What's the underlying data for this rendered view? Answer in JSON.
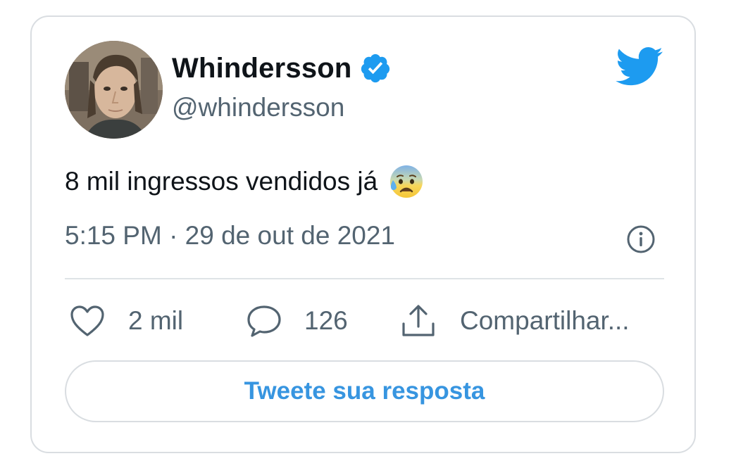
{
  "tweet": {
    "author": {
      "display_name": "Whindersson",
      "handle": "@whindersson",
      "verified": true,
      "avatar_icon": "profile-photo"
    },
    "text": "8 mil ingressos vendidos já",
    "emoji_icon": "anxious-face-with-sweat-emoji",
    "timestamp": "5:15 PM · 29 de out de 2021",
    "info_icon": "info-icon",
    "brand_icon": "twitter-bird-icon"
  },
  "actions": {
    "like": {
      "icon": "heart-icon",
      "label": "2 mil"
    },
    "reply": {
      "icon": "speech-bubble-icon",
      "label": "126"
    },
    "share": {
      "icon": "share-upload-icon",
      "label": "Compartilhar..."
    }
  },
  "reply_button": {
    "label": "Tweete sua resposta"
  },
  "colors": {
    "brand_blue": "#1d9bf0",
    "link_blue": "#3795e0",
    "text_primary": "#0f1419",
    "text_secondary": "#536471",
    "border": "#d9dde1"
  }
}
